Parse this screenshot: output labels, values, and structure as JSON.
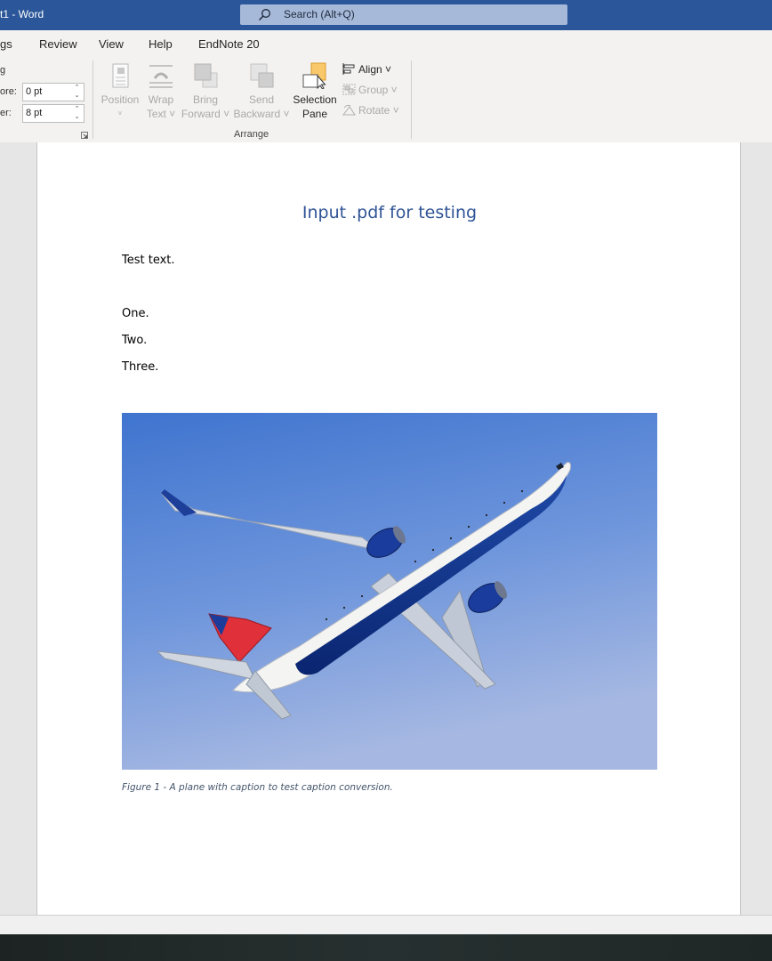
{
  "window": {
    "title": "t1  -  Word"
  },
  "search": {
    "placeholder": "Search (Alt+Q)"
  },
  "tabs": [
    {
      "label": "gs"
    },
    {
      "label": "Review"
    },
    {
      "label": "View"
    },
    {
      "label": "Help"
    },
    {
      "label": "EndNote 20"
    }
  ],
  "ribbon": {
    "spacing": {
      "truncated_header": "g",
      "before_label": "ore:",
      "before_value": "0 pt",
      "after_label": "er:",
      "after_value": "8 pt"
    },
    "arrange": {
      "group_label": "Arrange",
      "position": {
        "line1": "Position",
        "line2": "˅"
      },
      "wrap_text": {
        "line1": "Wrap",
        "line2": "Text ˅"
      },
      "bring_forward": {
        "line1": "Bring",
        "line2": "Forward ˅"
      },
      "send_backward": {
        "line1": "Send",
        "line2": "Backward ˅"
      },
      "selection_pane": {
        "line1": "Selection",
        "line2": "Pane"
      },
      "align": "Align ˅",
      "group": "Group ˅",
      "rotate": "Rotate ˅"
    }
  },
  "document": {
    "title": "Input .pdf for testing",
    "paragraphs": [
      "Test text.",
      "One.",
      "Two.",
      "Three."
    ],
    "caption": "Figure 1 - A plane with caption to test caption conversion."
  },
  "colors": {
    "titlebar": "#2b579a",
    "heading": "#2f5496",
    "caption": "#44546a",
    "sky": "#4a7fd4",
    "fuselage_blue": "#0b2a78",
    "tail_red": "#e0303a"
  }
}
